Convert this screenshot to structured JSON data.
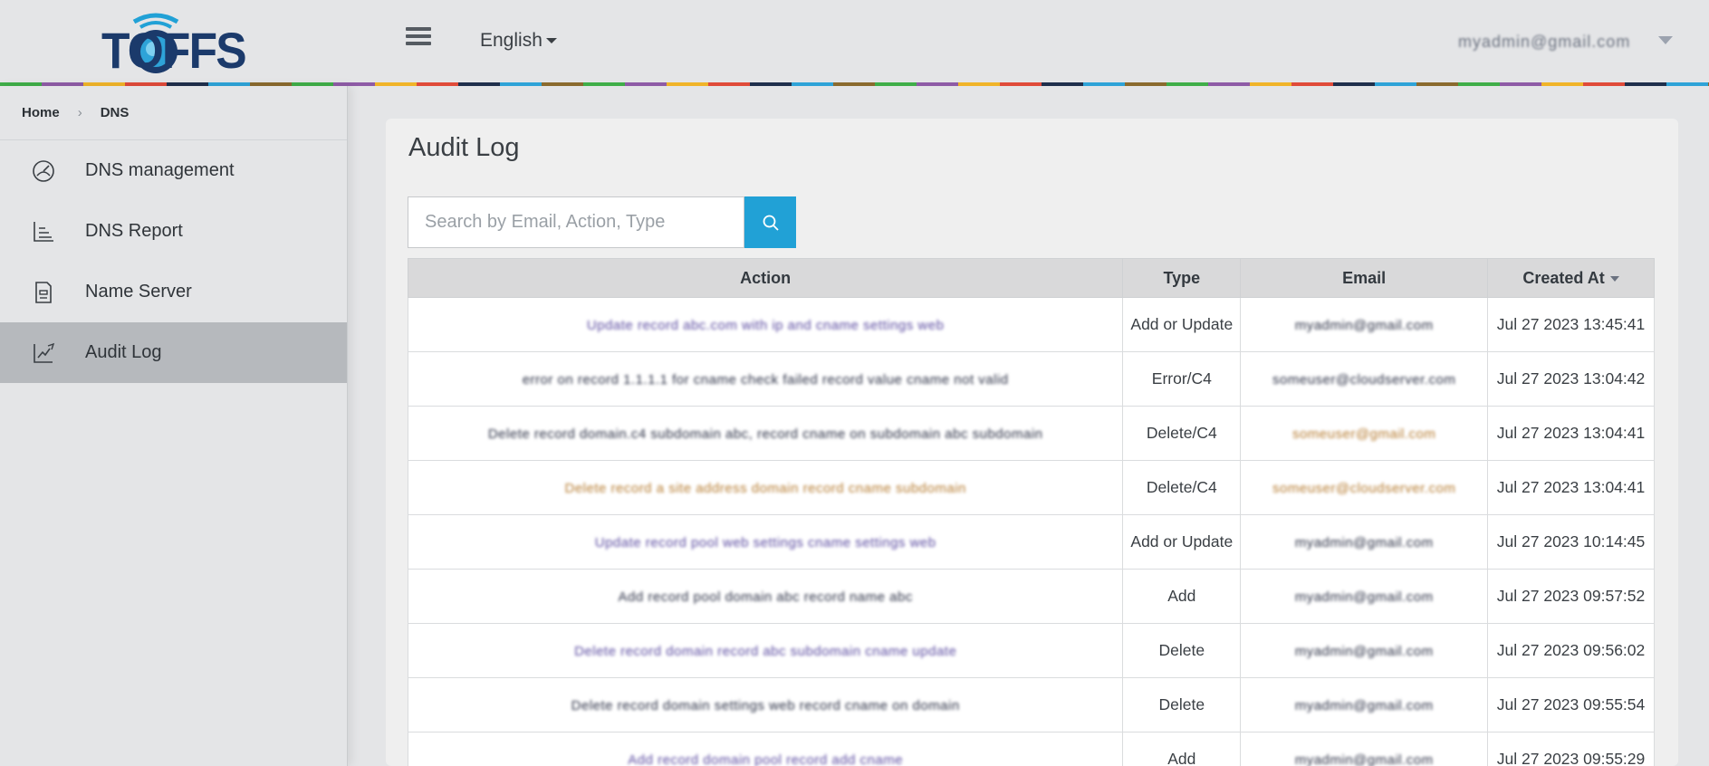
{
  "header": {
    "logo_text": "TOFFS",
    "language": "English",
    "user": "myadmin@gmail.com"
  },
  "breadcrumb": {
    "home": "Home",
    "current": "DNS"
  },
  "sidebar": {
    "items": [
      {
        "label": "DNS management",
        "icon": "gauge-icon"
      },
      {
        "label": "DNS Report",
        "icon": "chart-icon"
      },
      {
        "label": "Name Server",
        "icon": "document-icon"
      },
      {
        "label": "Audit Log",
        "icon": "edit-chart-icon"
      }
    ],
    "active_index": 3
  },
  "main": {
    "title": "Audit Log",
    "search_placeholder": "Search by Email, Action, Type",
    "columns": [
      "Action",
      "Type",
      "Email",
      "Created At"
    ],
    "rows": [
      {
        "action": "Update record abc.com with ip and cname settings web",
        "type": "Add or Update",
        "email": "myadmin@gmail.com",
        "created_at": "Jul 27 2023 13:45:41"
      },
      {
        "action": "error on record 1.1.1.1 for cname check failed record value cname not valid",
        "type": "Error/C4",
        "email": "someuser@cloudserver.com",
        "created_at": "Jul 27 2023 13:04:42"
      },
      {
        "action": "Delete record domain.c4 subdomain abc, record cname on subdomain abc subdomain",
        "type": "Delete/C4",
        "email": "someuser@gmail.com",
        "created_at": "Jul 27 2023 13:04:41"
      },
      {
        "action": "Delete record a site address domain record cname subdomain",
        "type": "Delete/C4",
        "email": "someuser@cloudserver.com",
        "created_at": "Jul 27 2023 13:04:41"
      },
      {
        "action": "Update record pool web settings cname settings web",
        "type": "Add or Update",
        "email": "myadmin@gmail.com",
        "created_at": "Jul 27 2023 10:14:45"
      },
      {
        "action": "Add record pool domain abc record name abc",
        "type": "Add",
        "email": "myadmin@gmail.com",
        "created_at": "Jul 27 2023 09:57:52"
      },
      {
        "action": "Delete record domain record abc subdomain cname update",
        "type": "Delete",
        "email": "myadmin@gmail.com",
        "created_at": "Jul 27 2023 09:56:02"
      },
      {
        "action": "Delete record domain settings web record cname on domain",
        "type": "Delete",
        "email": "myadmin@gmail.com",
        "created_at": "Jul 27 2023 09:55:54"
      },
      {
        "action": "Add record domain pool record add cname",
        "type": "Add",
        "email": "myadmin@gmail.com",
        "created_at": "Jul 27 2023 09:55:29"
      }
    ]
  },
  "colors": {
    "accent": "#21a1d6",
    "logo": "#1b3a6b",
    "active_nav": "#b6b9bd"
  }
}
